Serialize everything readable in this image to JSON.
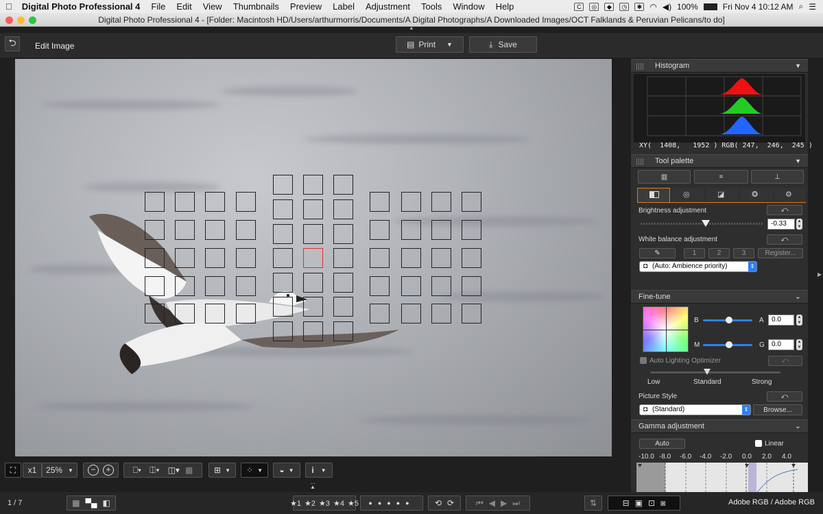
{
  "menubar": {
    "app_name": "Digital Photo Professional 4",
    "items": [
      "File",
      "Edit",
      "View",
      "Thumbnails",
      "Preview",
      "Label",
      "Adjustment",
      "Tools",
      "Window",
      "Help"
    ],
    "battery": "100%",
    "clock": "Fri Nov 4  10:12 AM"
  },
  "window": {
    "title": "Digital Photo Professional 4 - [Folder: Macintosh HD/Users/arthurmorris/Documents/A Digital Photographs/A Downloaded Images/OCT Falklands & Peruvian Pelicans/to do]"
  },
  "toolbar": {
    "mode_label": "Edit Image",
    "print_label": "Print",
    "save_label": "Save"
  },
  "histogram": {
    "title": "Histogram",
    "readout": "XY(  1408,   1952 ) RGB( 247,  246,  245 )"
  },
  "tool_palette": {
    "title": "Tool palette",
    "brightness_label": "Brightness adjustment",
    "brightness_value": "-0.33",
    "brightness_level": 0.53,
    "white_balance_label": "White balance adjustment",
    "wb_buttons": [
      "1",
      "2",
      "3"
    ],
    "register_label": "Register...",
    "wb_select": "(Auto: Ambience priority)"
  },
  "fine_tune": {
    "title": "Fine-tune",
    "b_label": "B",
    "a_label": "A",
    "a_value": "0.0",
    "m_label": "M",
    "g_label": "G",
    "g_value": "0.0",
    "alo_label": "Auto Lighting Optimizer",
    "alo_levels": [
      "Low",
      "Standard",
      "Strong"
    ],
    "picture_style_label": "Picture Style",
    "picture_style_value": "(Standard)",
    "browse_label": "Browse..."
  },
  "gamma": {
    "title": "Gamma adjustment",
    "auto_label": "Auto",
    "linear_label": "Linear",
    "scale": [
      "-10.0",
      "-8.0",
      "-6.0",
      "-4.0",
      "-2.0",
      "0.0",
      "2.0",
      "4.0"
    ]
  },
  "view_controls": {
    "zoom_multiplier": "x1",
    "zoom_percent": "25%"
  },
  "status": {
    "page_counter": "1 / 7",
    "ratings": [
      "1",
      "2",
      "3",
      "4",
      "5"
    ],
    "color_space": "Adobe RGB / Adobe RGB"
  }
}
